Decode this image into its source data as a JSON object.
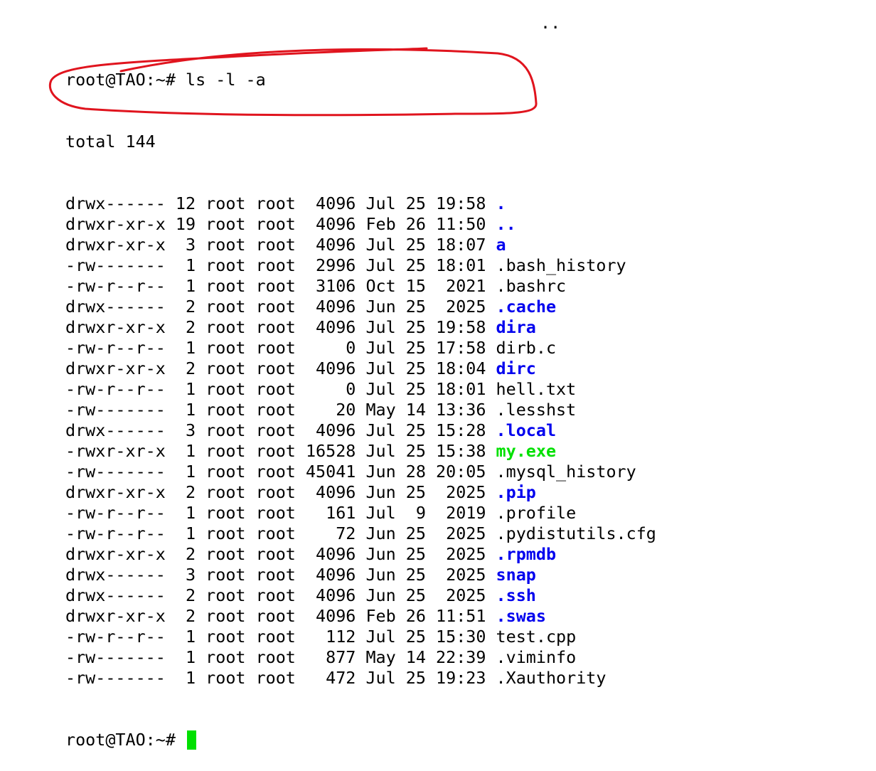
{
  "terminal": {
    "stray_text": "..",
    "prompt": "root@TAO:~# ",
    "command": "ls -l -a",
    "total": "total 144",
    "entries": [
      {
        "meta": "drwx------ 12 root root  4096 Jul 25 19:58 ",
        "name": ".",
        "kind": "dir"
      },
      {
        "meta": "drwxr-xr-x 19 root root  4096 Feb 26 11:50 ",
        "name": "..",
        "kind": "dir"
      },
      {
        "meta": "drwxr-xr-x  3 root root  4096 Jul 25 18:07 ",
        "name": "a",
        "kind": "dir"
      },
      {
        "meta": "-rw-------  1 root root  2996 Jul 25 18:01 ",
        "name": ".bash_history",
        "kind": "file"
      },
      {
        "meta": "-rw-r--r--  1 root root  3106 Oct 15  2021 ",
        "name": ".bashrc",
        "kind": "file"
      },
      {
        "meta": "drwx------  2 root root  4096 Jun 25  2025 ",
        "name": ".cache",
        "kind": "dir"
      },
      {
        "meta": "drwxr-xr-x  2 root root  4096 Jul 25 19:58 ",
        "name": "dira",
        "kind": "dir"
      },
      {
        "meta": "-rw-r--r--  1 root root     0 Jul 25 17:58 ",
        "name": "dirb.c",
        "kind": "file"
      },
      {
        "meta": "drwxr-xr-x  2 root root  4096 Jul 25 18:04 ",
        "name": "dirc",
        "kind": "dir"
      },
      {
        "meta": "-rw-r--r--  1 root root     0 Jul 25 18:01 ",
        "name": "hell.txt",
        "kind": "file"
      },
      {
        "meta": "-rw-------  1 root root    20 May 14 13:36 ",
        "name": ".lesshst",
        "kind": "file"
      },
      {
        "meta": "drwx------  3 root root  4096 Jul 25 15:28 ",
        "name": ".local",
        "kind": "dir"
      },
      {
        "meta": "-rwxr-xr-x  1 root root 16528 Jul 25 15:38 ",
        "name": "my.exe",
        "kind": "exe"
      },
      {
        "meta": "-rw-------  1 root root 45041 Jun 28 20:05 ",
        "name": ".mysql_history",
        "kind": "file"
      },
      {
        "meta": "drwxr-xr-x  2 root root  4096 Jun 25  2025 ",
        "name": ".pip",
        "kind": "dir"
      },
      {
        "meta": "-rw-r--r--  1 root root   161 Jul  9  2019 ",
        "name": ".profile",
        "kind": "file"
      },
      {
        "meta": "-rw-r--r--  1 root root    72 Jun 25  2025 ",
        "name": ".pydistutils.cfg",
        "kind": "file"
      },
      {
        "meta": "drwxr-xr-x  2 root root  4096 Jun 25  2025 ",
        "name": ".rpmdb",
        "kind": "dir"
      },
      {
        "meta": "drwx------  3 root root  4096 Jun 25  2025 ",
        "name": "snap",
        "kind": "dir"
      },
      {
        "meta": "drwx------  2 root root  4096 Jun 25  2025 ",
        "name": ".ssh",
        "kind": "dir"
      },
      {
        "meta": "drwxr-xr-x  2 root root  4096 Feb 26 11:51 ",
        "name": ".swas",
        "kind": "dir"
      },
      {
        "meta": "-rw-r--r--  1 root root   112 Jul 25 15:30 ",
        "name": "test.cpp",
        "kind": "file"
      },
      {
        "meta": "-rw-------  1 root root   877 May 14 22:39 ",
        "name": ".viminfo",
        "kind": "file"
      },
      {
        "meta": "-rw-------  1 root root   472 Jul 25 19:23 ",
        "name": ".Xauthority",
        "kind": "file"
      }
    ]
  },
  "colors": {
    "background": "#ffffff",
    "text": "#000000",
    "directory": "#0000ee",
    "executable": "#00e000",
    "cursor": "#00e000",
    "annotation": "#e0141e"
  }
}
